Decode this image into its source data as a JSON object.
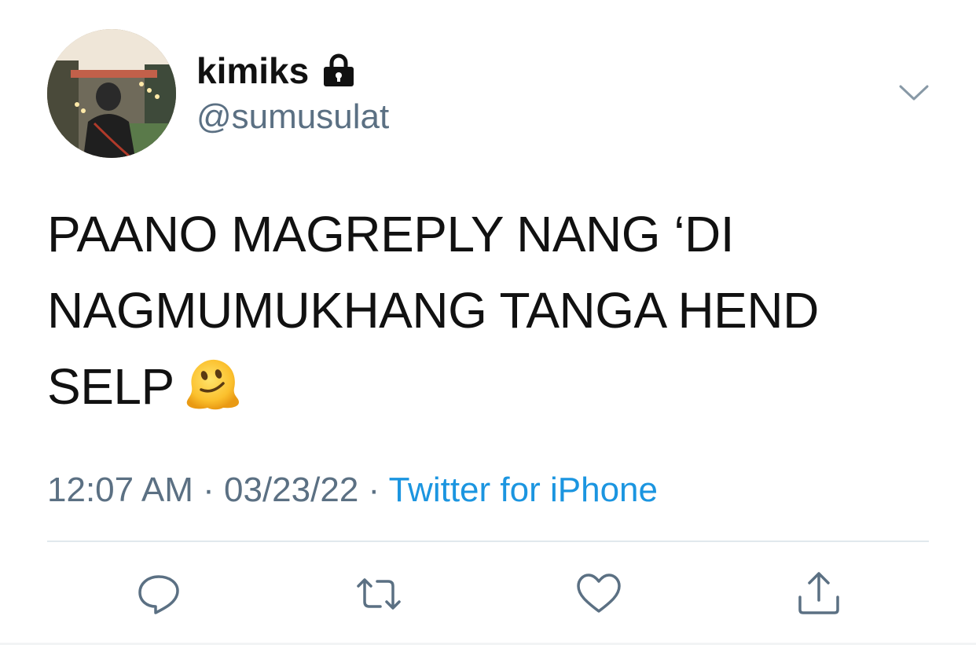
{
  "tweet": {
    "user": {
      "display_name": "kimiks",
      "handle": "@sumusulat",
      "protected_icon": "lock-icon",
      "avatar_icon": "avatar-photo"
    },
    "text_lines": [
      "PAANO MAGREPLY NANG ‘DI",
      "NAGMUMUKHANG TANGA HEND",
      "SELP"
    ],
    "emoji": "melting-face-emoji",
    "meta": {
      "time": "12:07 AM",
      "separator": " · ",
      "date": "03/23/22",
      "source": "Twitter for iPhone"
    },
    "menu_icon": "chevron-down-icon",
    "actions": [
      {
        "icon": "reply-icon"
      },
      {
        "icon": "retweet-icon"
      },
      {
        "icon": "like-icon"
      },
      {
        "icon": "share-icon"
      }
    ]
  },
  "colors": {
    "primary_text": "#111111",
    "secondary_text": "#5b7083",
    "link": "#1b95e0",
    "divider": "#e1e8ed",
    "icon": "#5b7083"
  }
}
